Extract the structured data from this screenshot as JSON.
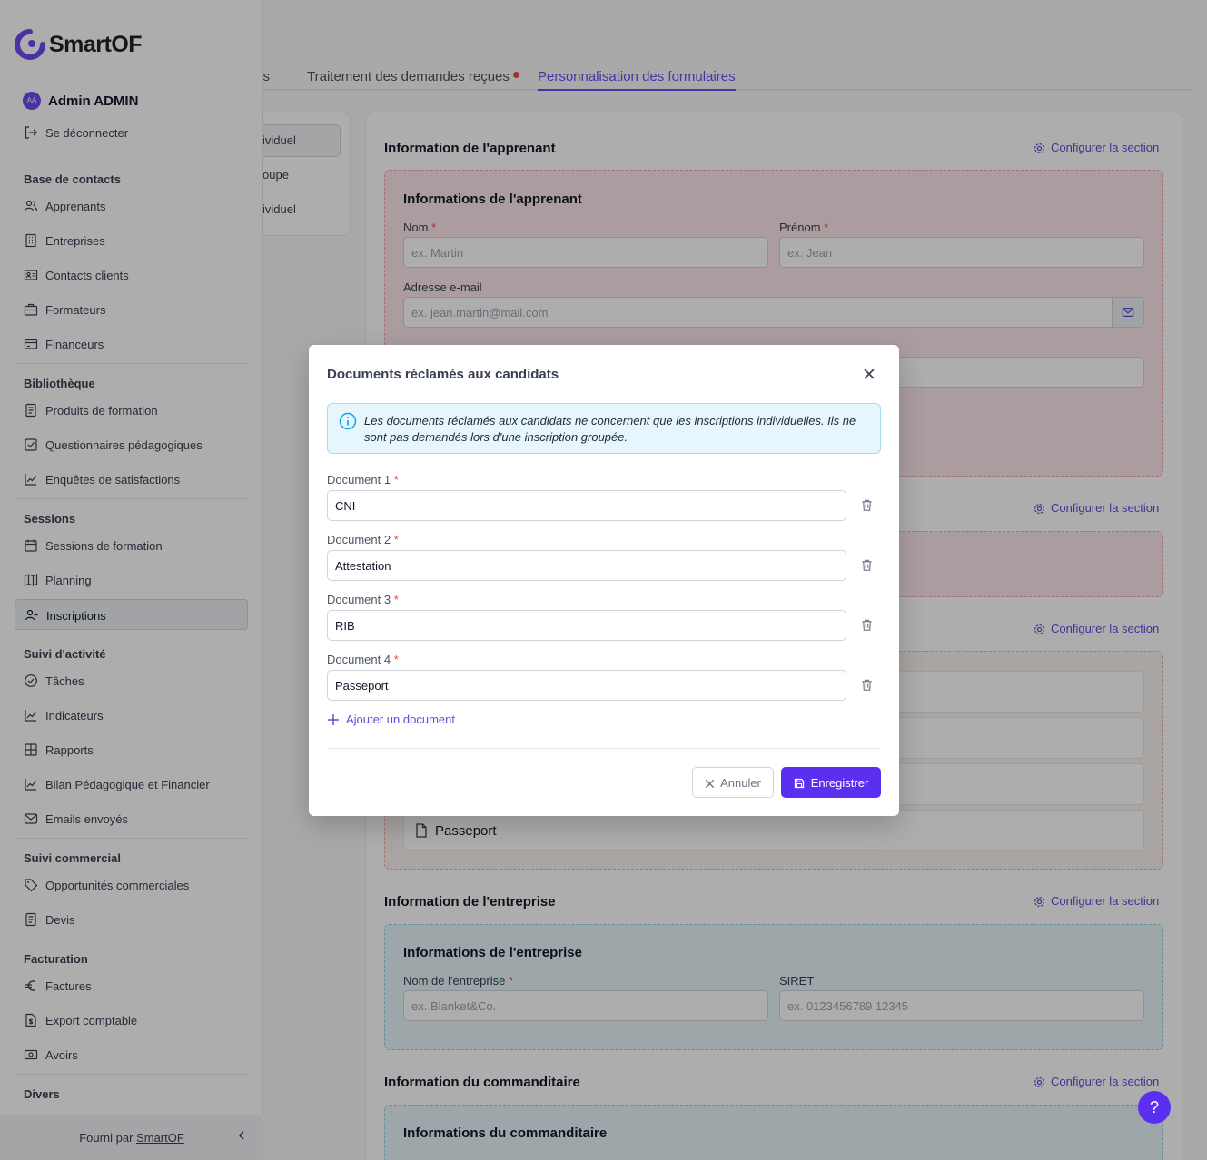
{
  "tabs": [
    {
      "label": "Offres ouvertes",
      "visible": "rtes"
    },
    {
      "label": "Traitement des demandes reçues"
    },
    {
      "label": "Personnalisation des formulaires"
    }
  ],
  "left_panel": {
    "items": [
      "ividuel",
      "oupe",
      "ividuel"
    ]
  },
  "sections": {
    "apprenant": {
      "title": "Information de l'apprenant",
      "config_label": "Configurer la section",
      "subtitle": "Informations de l'apprenant",
      "nom_label": "Nom",
      "nom_placeholder": "ex. Martin",
      "prenom_label": "Prénom",
      "prenom_placeholder": "ex. Jean",
      "email_label": "Adresse e-mail",
      "email_placeholder": "ex. jean.martin@mail.com"
    },
    "section2_config": "Configurer la section",
    "section3_config": "Configurer la section",
    "documents_visible": [
      "Passeport"
    ],
    "entreprise": {
      "title": "Information de l'entreprise",
      "config_label": "Configurer la section",
      "subtitle": "Informations de l'entreprise",
      "nom_label": "Nom de l'entreprise",
      "nom_placeholder": "ex. Blanket&Co.",
      "siret_label": "SIRET",
      "siret_placeholder": "ex. 0123456789 12345"
    },
    "commanditaire": {
      "title": "Information du commanditaire",
      "config_label": "Configurer la section",
      "subtitle": "Informations du commanditaire"
    }
  },
  "sidebar": {
    "brand": "SmartOF",
    "user_initials": "AA",
    "user_name": "Admin ADMIN",
    "logout": "Se déconnecter",
    "groups": [
      {
        "title": "Base de contacts",
        "items": [
          "Apprenants",
          "Entreprises",
          "Contacts clients",
          "Formateurs",
          "Financeurs"
        ]
      },
      {
        "title": "Bibliothèque",
        "items": [
          "Produits de formation",
          "Questionnaires pédagogiques",
          "Enquêtes de satisfactions"
        ]
      },
      {
        "title": "Sessions",
        "items": [
          "Sessions de formation",
          "Planning",
          "Inscriptions"
        ]
      },
      {
        "title": "Suivi d'activité",
        "items": [
          "Tâches",
          "Indicateurs",
          "Rapports",
          "Bilan Pédagogique et Financier",
          "Emails envoyés"
        ]
      },
      {
        "title": "Suivi commercial",
        "items": [
          "Opportunités commerciales",
          "Devis"
        ]
      },
      {
        "title": "Facturation",
        "items": [
          "Factures",
          "Export comptable",
          "Avoirs"
        ]
      },
      {
        "title": "Divers",
        "items": []
      }
    ],
    "footer_prefix": "Fourni par",
    "footer_link": "SmartOF"
  },
  "modal": {
    "title": "Documents réclamés aux candidats",
    "info": "Les documents réclamés aux candidats ne concernent que les inscriptions individuelles. Ils ne sont pas demandés lors d'une inscription groupée.",
    "documents": [
      {
        "label": "Document 1",
        "value": "CNI"
      },
      {
        "label": "Document 2",
        "value": "Attestation"
      },
      {
        "label": "Document 3",
        "value": "RIB"
      },
      {
        "label": "Document 4",
        "value": "Passeport"
      }
    ],
    "add_label": "Ajouter un document",
    "cancel_label": "Annuler",
    "save_label": "Enregistrer"
  },
  "help_label": "?",
  "colors": {
    "accent": "#5b2ff0",
    "link": "#5b50d6",
    "required": "#ef4444"
  }
}
